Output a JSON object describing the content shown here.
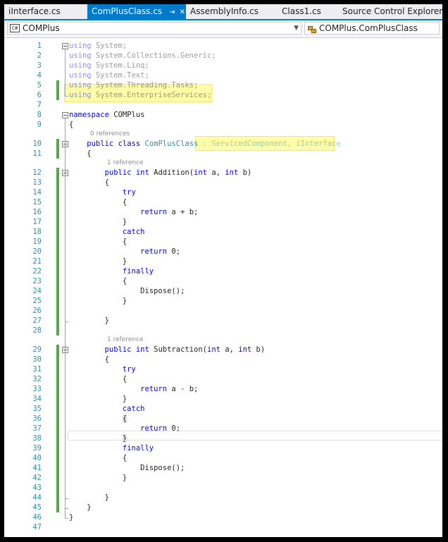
{
  "tabs": [
    {
      "label": "iInterface.cs",
      "active": false
    },
    {
      "label": "ComPlusClass.cs",
      "active": true
    },
    {
      "label": "AssemblyInfo.cs",
      "active": false
    },
    {
      "label": "Class1.cs",
      "active": false
    },
    {
      "label": "Source Control Explorer",
      "active": false
    }
  ],
  "tab_icons": {
    "pin": "pin-icon",
    "close": "close-icon"
  },
  "navbar": {
    "project": "COMPlus",
    "project_icon": "csharp-icon",
    "project_icon_text": "C#",
    "type": "COMPlus.ComPlusClass",
    "type_icon": "class-icon"
  },
  "code_lines": [
    {
      "n": "1",
      "parts": [
        {
          "t": "using",
          "k": "kw dim"
        },
        {
          "t": " System;",
          "k": "dim"
        }
      ]
    },
    {
      "n": "2",
      "parts": [
        {
          "t": "using",
          "k": "kw dim"
        },
        {
          "t": " System.Collections.Generic;",
          "k": "dim"
        }
      ]
    },
    {
      "n": "3",
      "parts": [
        {
          "t": "using",
          "k": "kw dim"
        },
        {
          "t": " System.Linq;",
          "k": "dim"
        }
      ]
    },
    {
      "n": "4",
      "parts": [
        {
          "t": "using",
          "k": "kw dim"
        },
        {
          "t": " System.Text;",
          "k": "dim"
        }
      ]
    },
    {
      "n": "5",
      "parts": [
        {
          "t": "using",
          "k": "kw dim"
        },
        {
          "t": " System.Threading.Tasks;",
          "k": "dim"
        }
      ]
    },
    {
      "n": "6",
      "parts": [
        {
          "t": "using",
          "k": "kw dim"
        },
        {
          "t": " System.EnterpriseServices;",
          "k": "dim"
        }
      ]
    },
    {
      "n": "7",
      "parts": []
    },
    {
      "n": "8",
      "parts": [
        {
          "t": "namespace",
          "k": "kw"
        },
        {
          "t": " COMPlus",
          "k": ""
        }
      ]
    },
    {
      "n": "9",
      "parts": [
        {
          "t": "{",
          "k": ""
        }
      ]
    },
    {
      "n": "10",
      "lens": "0 references",
      "parts": [
        {
          "t": "    ",
          "k": ""
        },
        {
          "t": "public",
          "k": "kw"
        },
        {
          "t": " ",
          "k": ""
        },
        {
          "t": "class",
          "k": "kw"
        },
        {
          "t": " ",
          "k": ""
        },
        {
          "t": "ComPlusClass",
          "k": "cl"
        },
        {
          "t": " : ServicedComponent, iInterface",
          "k": "cl dim"
        }
      ]
    },
    {
      "n": "11",
      "parts": [
        {
          "t": "    {",
          "k": ""
        }
      ]
    },
    {
      "n": "12",
      "lens": "1 reference",
      "parts": [
        {
          "t": "        ",
          "k": ""
        },
        {
          "t": "public",
          "k": "kw"
        },
        {
          "t": " ",
          "k": ""
        },
        {
          "t": "int",
          "k": "kw"
        },
        {
          "t": " Addition(",
          "k": ""
        },
        {
          "t": "int",
          "k": "kw"
        },
        {
          "t": " a, ",
          "k": ""
        },
        {
          "t": "int",
          "k": "kw"
        },
        {
          "t": " b)",
          "k": ""
        }
      ]
    },
    {
      "n": "13",
      "parts": [
        {
          "t": "        {",
          "k": ""
        }
      ]
    },
    {
      "n": "14",
      "parts": [
        {
          "t": "            ",
          "k": ""
        },
        {
          "t": "try",
          "k": "kw"
        }
      ]
    },
    {
      "n": "15",
      "parts": [
        {
          "t": "            {",
          "k": ""
        }
      ]
    },
    {
      "n": "16",
      "parts": [
        {
          "t": "                ",
          "k": ""
        },
        {
          "t": "return",
          "k": "kw"
        },
        {
          "t": " a + b;",
          "k": ""
        }
      ]
    },
    {
      "n": "17",
      "parts": [
        {
          "t": "            }",
          "k": ""
        }
      ]
    },
    {
      "n": "18",
      "parts": [
        {
          "t": "            ",
          "k": ""
        },
        {
          "t": "catch",
          "k": "kw"
        }
      ]
    },
    {
      "n": "19",
      "parts": [
        {
          "t": "            {",
          "k": ""
        }
      ]
    },
    {
      "n": "20",
      "parts": [
        {
          "t": "                ",
          "k": ""
        },
        {
          "t": "return",
          "k": "kw"
        },
        {
          "t": " 0;",
          "k": ""
        }
      ]
    },
    {
      "n": "21",
      "parts": [
        {
          "t": "            }",
          "k": ""
        }
      ]
    },
    {
      "n": "22",
      "parts": [
        {
          "t": "            ",
          "k": ""
        },
        {
          "t": "finally",
          "k": "kw"
        }
      ]
    },
    {
      "n": "23",
      "parts": [
        {
          "t": "            {",
          "k": ""
        }
      ]
    },
    {
      "n": "24",
      "parts": [
        {
          "t": "                Dispose();",
          "k": ""
        }
      ]
    },
    {
      "n": "25",
      "parts": [
        {
          "t": "            }",
          "k": ""
        }
      ]
    },
    {
      "n": "26",
      "parts": []
    },
    {
      "n": "27",
      "parts": [
        {
          "t": "        }",
          "k": ""
        }
      ]
    },
    {
      "n": "28",
      "parts": []
    },
    {
      "n": "29",
      "lens": "1 reference",
      "parts": [
        {
          "t": "        ",
          "k": ""
        },
        {
          "t": "public",
          "k": "kw"
        },
        {
          "t": " ",
          "k": ""
        },
        {
          "t": "int",
          "k": "kw"
        },
        {
          "t": " Subtraction(",
          "k": ""
        },
        {
          "t": "int",
          "k": "kw"
        },
        {
          "t": " a, ",
          "k": ""
        },
        {
          "t": "int",
          "k": "kw"
        },
        {
          "t": " b)",
          "k": ""
        }
      ]
    },
    {
      "n": "30",
      "parts": [
        {
          "t": "        {",
          "k": ""
        }
      ]
    },
    {
      "n": "31",
      "parts": [
        {
          "t": "            ",
          "k": ""
        },
        {
          "t": "try",
          "k": "kw"
        }
      ]
    },
    {
      "n": "32",
      "parts": [
        {
          "t": "            {",
          "k": ""
        }
      ]
    },
    {
      "n": "33",
      "parts": [
        {
          "t": "                ",
          "k": ""
        },
        {
          "t": "return",
          "k": "kw"
        },
        {
          "t": " a - b;",
          "k": ""
        }
      ]
    },
    {
      "n": "34",
      "parts": [
        {
          "t": "            }",
          "k": ""
        }
      ]
    },
    {
      "n": "35",
      "parts": [
        {
          "t": "            ",
          "k": ""
        },
        {
          "t": "catch",
          "k": "kw"
        }
      ]
    },
    {
      "n": "36",
      "parts": [
        {
          "t": "            ",
          "k": ""
        },
        {
          "t": "{",
          "k": "bm"
        }
      ]
    },
    {
      "n": "37",
      "parts": [
        {
          "t": "                ",
          "k": ""
        },
        {
          "t": "return",
          "k": "kw"
        },
        {
          "t": " 0;",
          "k": ""
        }
      ]
    },
    {
      "n": "38",
      "parts": [
        {
          "t": "            ",
          "k": ""
        },
        {
          "t": "}",
          "k": "bm"
        }
      ]
    },
    {
      "n": "39",
      "parts": [
        {
          "t": "            ",
          "k": ""
        },
        {
          "t": "finally",
          "k": "kw"
        }
      ]
    },
    {
      "n": "40",
      "parts": [
        {
          "t": "            {",
          "k": ""
        }
      ]
    },
    {
      "n": "41",
      "parts": [
        {
          "t": "                Dispose();",
          "k": ""
        }
      ]
    },
    {
      "n": "42",
      "parts": [
        {
          "t": "            }",
          "k": ""
        }
      ]
    },
    {
      "n": "43",
      "parts": []
    },
    {
      "n": "44",
      "parts": [
        {
          "t": "        }",
          "k": ""
        }
      ]
    },
    {
      "n": "45",
      "parts": [
        {
          "t": "    }",
          "k": ""
        }
      ]
    },
    {
      "n": "46",
      "parts": [
        {
          "t": "}",
          "k": ""
        }
      ]
    },
    {
      "n": "47",
      "parts": []
    }
  ],
  "colors": {
    "keyword": "#0000ff",
    "type": "#2b91af",
    "line_number": "#2b91af",
    "change_bar": "#57a64a",
    "tab_active": "#007acc",
    "highlight": "#fffda8"
  }
}
